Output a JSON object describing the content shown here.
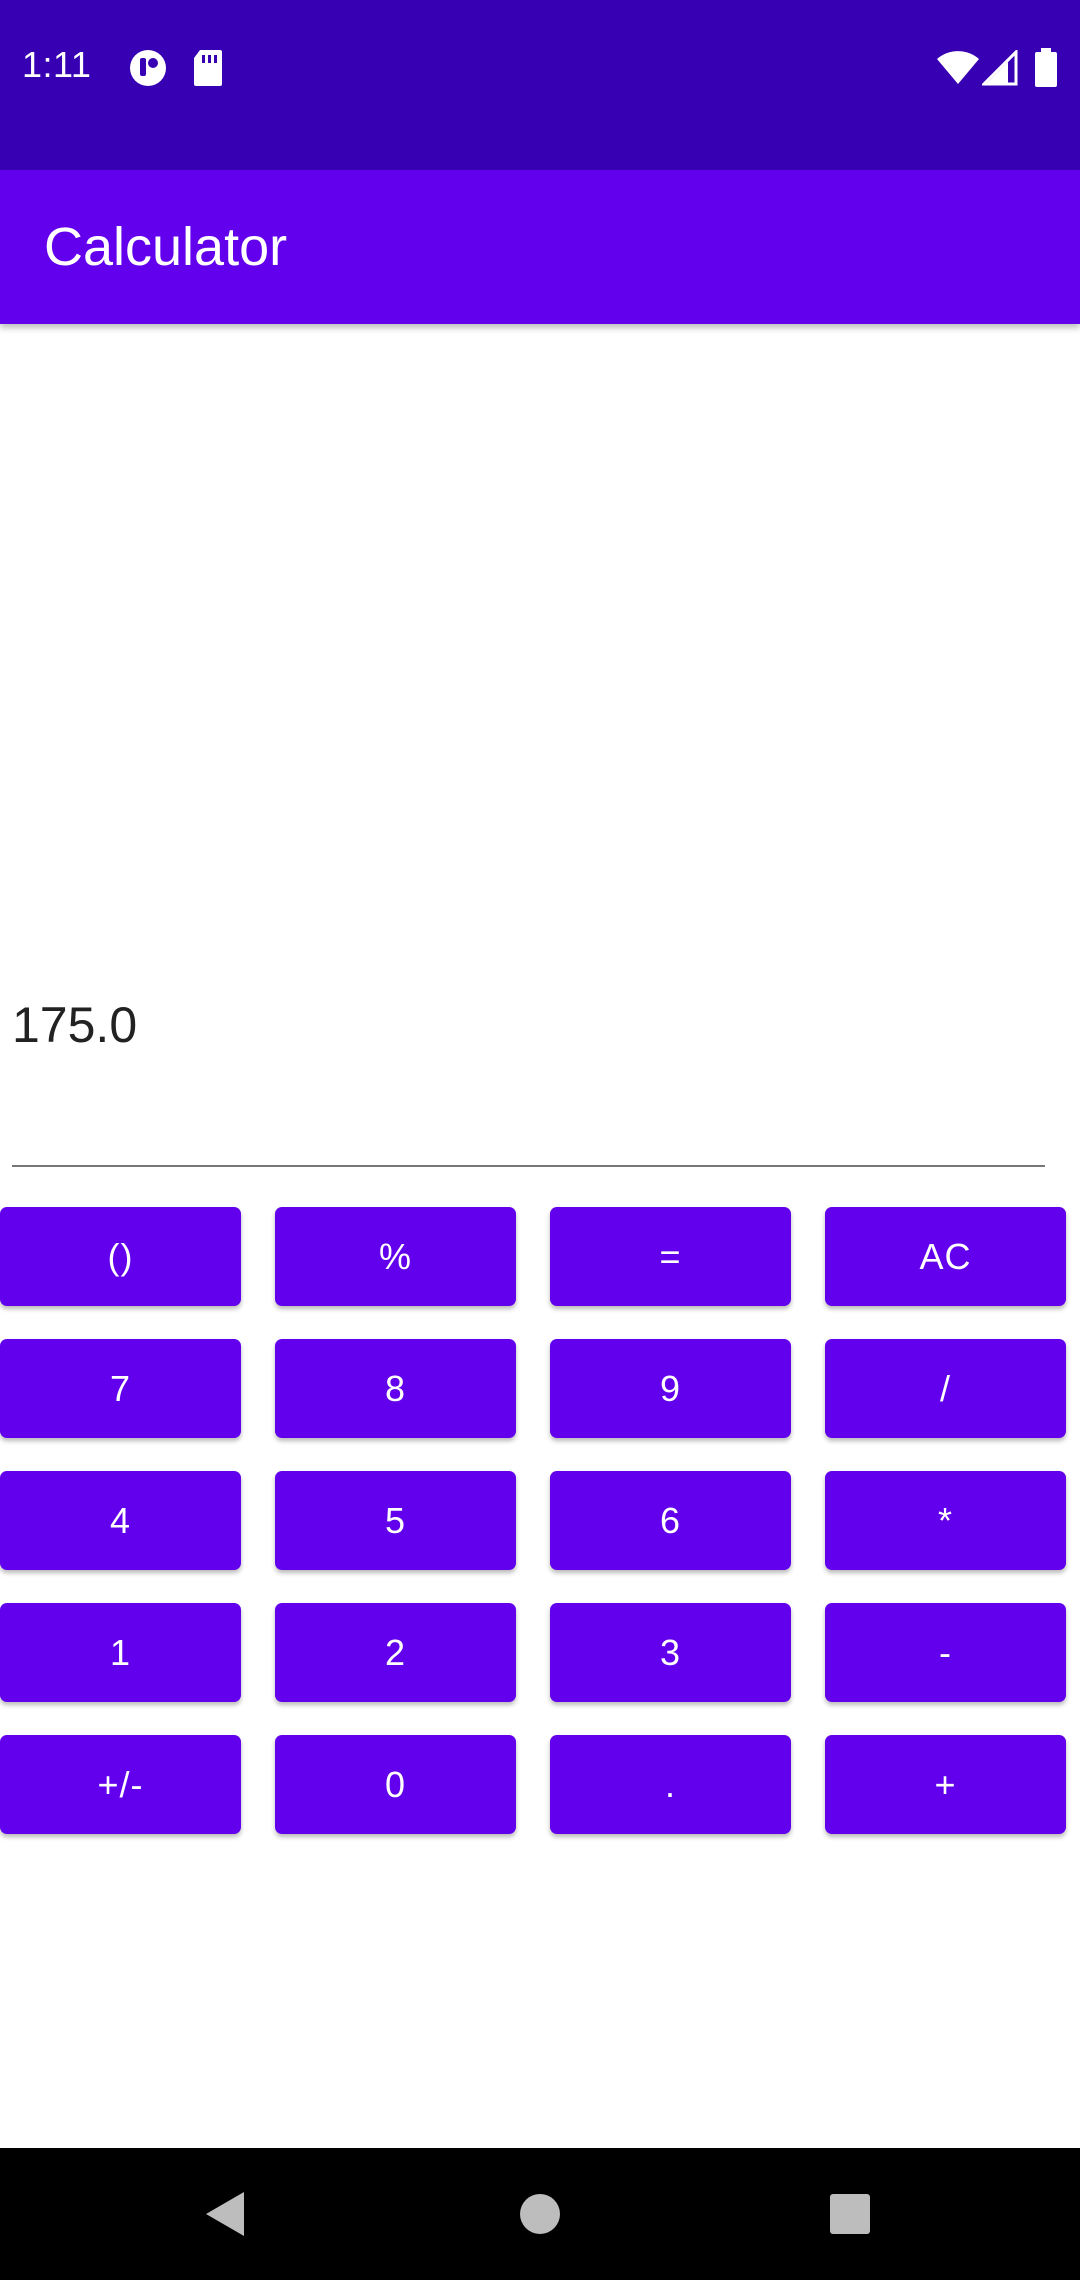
{
  "status_bar": {
    "time": "1:11",
    "icons": [
      "app-notification-icon",
      "sd-card-icon",
      "wifi-icon",
      "signal-icon",
      "battery-icon"
    ],
    "background": "#3700b3"
  },
  "app_bar": {
    "title": "Calculator",
    "background": "#6200ee"
  },
  "display": {
    "value": "175.0"
  },
  "keypad": {
    "rows": [
      [
        "()",
        "%",
        "=",
        "AC"
      ],
      [
        "7",
        "8",
        "9",
        "/"
      ],
      [
        "4",
        "5",
        "6",
        "*"
      ],
      [
        "1",
        "2",
        "3",
        "-"
      ],
      [
        "+/-",
        "0",
        ".",
        "+"
      ]
    ],
    "button_color": "#6200ee",
    "text_color": "#ffffff"
  },
  "nav_bar": {
    "buttons": [
      "back-icon",
      "home-icon",
      "recents-icon"
    ]
  }
}
